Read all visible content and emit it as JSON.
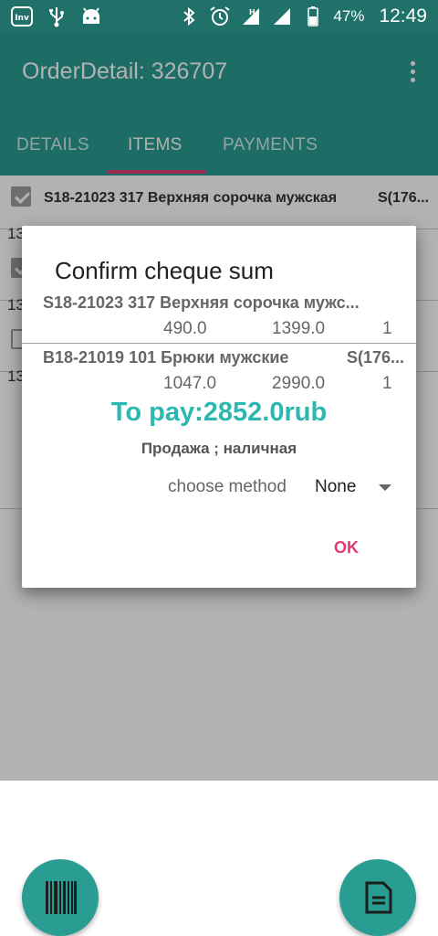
{
  "status_bar": {
    "battery": "47%",
    "time": "12:49",
    "icons": [
      "inventory-app-icon",
      "usb-icon",
      "android-icon",
      "bluetooth-icon",
      "alarm-icon",
      "signal-h-icon",
      "signal-icon",
      "battery-icon"
    ]
  },
  "app_bar": {
    "title": "OrderDetail: 326707",
    "tabs": [
      {
        "label": "DETAILS"
      },
      {
        "label": "ITEMS"
      },
      {
        "label": "PAYMENTS"
      }
    ],
    "active_tab": "ITEMS"
  },
  "list": {
    "rows": [
      {
        "title": "S18-21023 317 Верхняя сорочка мужская",
        "size": "S(176...",
        "num": "13",
        "checked": true
      },
      {
        "title": "",
        "size": "",
        "num": "13",
        "checked": true
      },
      {
        "title": "",
        "size": "",
        "num": "13",
        "checked": false
      }
    ]
  },
  "dialog": {
    "title": "Confirm cheque sum",
    "items": [
      {
        "name": "S18-21023 317 Верхняя сорочка мужс...",
        "size": "",
        "price": "490.0",
        "total": "1399.0",
        "qty": "1"
      },
      {
        "name": "B18-21019 101 Брюки мужские",
        "size": "S(176...",
        "price": "1047.0",
        "total": "2990.0",
        "qty": "1"
      }
    ],
    "to_pay": "To pay:2852.0rub",
    "payment_type": "Продажа ; наличная",
    "method_label": "choose method",
    "method_value": "None",
    "ok_label": "OK"
  },
  "colors": {
    "primary": "#2a9d93",
    "primary_dark": "#1f716a",
    "accent": "#e43a71",
    "to_pay": "#2cb8b0"
  }
}
